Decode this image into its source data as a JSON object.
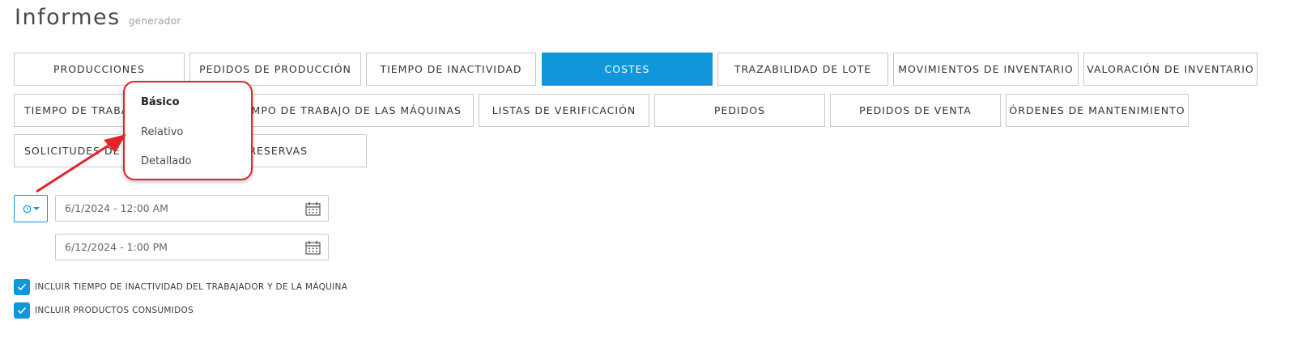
{
  "header": {
    "title": "Informes",
    "subtitle": "generador"
  },
  "tabs": {
    "row1": [
      {
        "label": "PRODUCCIONES",
        "active": false
      },
      {
        "label": "PEDIDOS DE PRODUCCIÓN",
        "active": false
      },
      {
        "label": "TIEMPO DE INACTIVIDAD",
        "active": false
      },
      {
        "label": "COSTES",
        "active": true
      },
      {
        "label": "TRAZABILIDAD DE LOTE",
        "active": false
      },
      {
        "label": "MOVIMIENTOS DE INVENTARIO",
        "active": false
      },
      {
        "label": "VALORACIÓN DE INVENTARIO",
        "active": false
      }
    ],
    "row2": [
      {
        "label": "TIEMPO DE TRABAJ",
        "active": false
      },
      {
        "label": "TIEMPO DE TRABAJO DE LAS MÁQUINAS",
        "active": false
      },
      {
        "label": "LISTAS DE VERIFICACIÓN",
        "active": false
      },
      {
        "label": "PEDIDOS",
        "active": false
      },
      {
        "label": "PEDIDOS DE VENTA",
        "active": false
      },
      {
        "label": "ÓRDENES DE MANTENIMIENTO",
        "active": false
      }
    ],
    "row3": [
      {
        "label": "SOLICITUDES DE M",
        "active": false
      },
      {
        "label": "RESERVAS",
        "active": false
      }
    ]
  },
  "dropdown": {
    "items": [
      "Básico",
      "Relativo",
      "Detallado"
    ],
    "selected": "Básico"
  },
  "filters": {
    "range_mode_icon": "clock-icon",
    "start_date": "6/1/2024 - 12:00 AM",
    "end_date": "6/12/2024 - 1:00 PM"
  },
  "options": [
    {
      "label": "INCLUIR TIEMPO DE INACTIVIDAD DEL TRABAJADOR Y DE LA MÁQUINA",
      "checked": true
    },
    {
      "label": "INCLUIR PRODUCTOS CONSUMIDOS",
      "checked": true
    }
  ],
  "colors": {
    "accent": "#0f96db",
    "annotation": "#e4232b"
  }
}
